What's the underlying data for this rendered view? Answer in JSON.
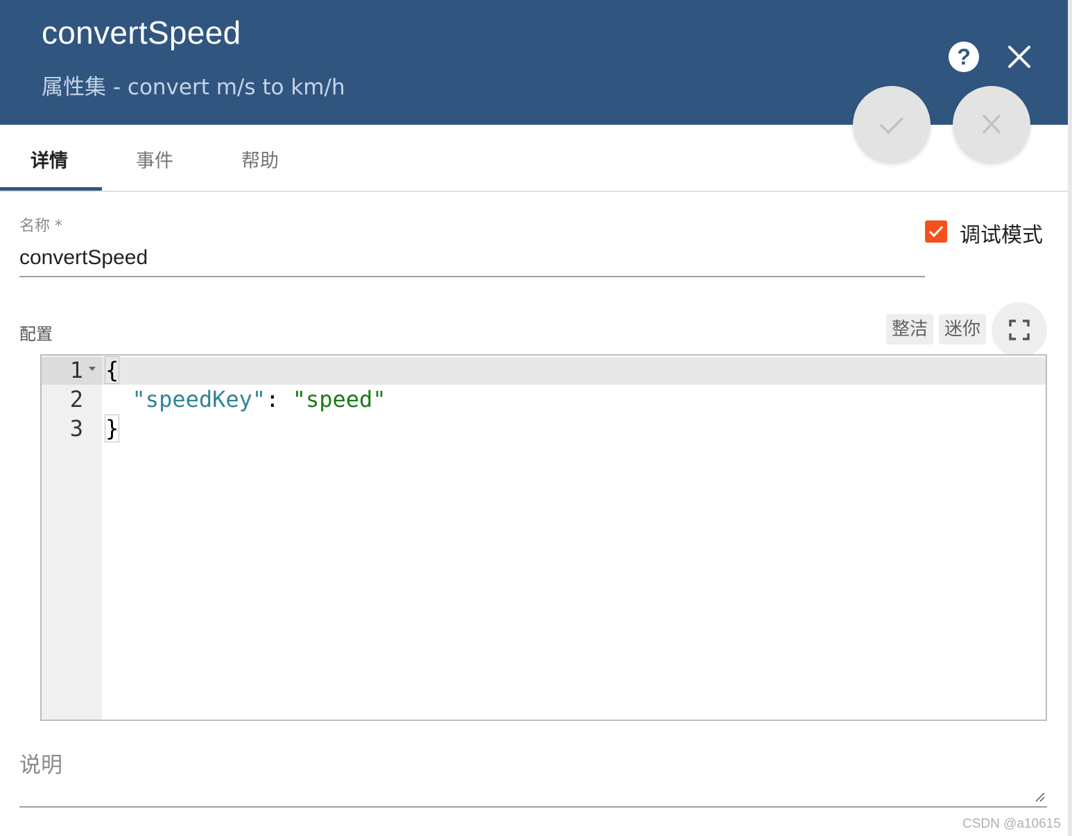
{
  "header": {
    "title": "convertSpeed",
    "subtitle": "属性集 - convert m/s to km/h",
    "help_glyph": "?",
    "icons": {
      "help": "help-circle-icon",
      "close": "close-icon",
      "confirm": "check-icon",
      "cancel": "close-icon"
    },
    "color": "#305680"
  },
  "tabs": [
    {
      "label": "详情",
      "active": true
    },
    {
      "label": "事件",
      "active": false
    },
    {
      "label": "帮助",
      "active": false
    }
  ],
  "name_field": {
    "label": "名称 *",
    "value": "convertSpeed"
  },
  "debug_mode": {
    "label": "调试模式",
    "checked": true,
    "color": "#f4511e"
  },
  "config": {
    "label": "配置",
    "buttons": {
      "tidy": "整洁",
      "mini": "迷你"
    },
    "fullscreen_icon": "fullscreen-icon",
    "editor": {
      "line_numbers": [
        "1",
        "2",
        "3"
      ],
      "line1": "{",
      "line2_key": "\"speedKey\"",
      "line2_colon": ": ",
      "line2_value": "\"speed\"",
      "line3": "}"
    }
  },
  "description": {
    "label": "说明",
    "value": ""
  },
  "watermark": "CSDN @a10615"
}
